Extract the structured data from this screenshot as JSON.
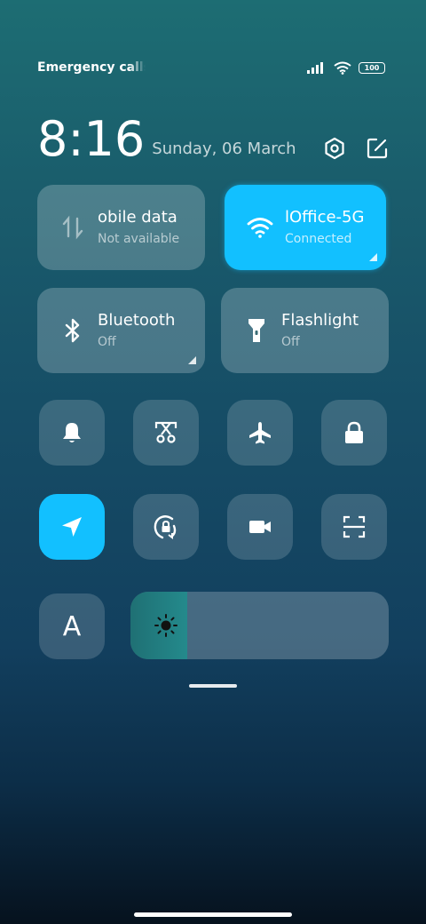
{
  "status_bar": {
    "carrier": "Emergency calls o",
    "battery": "100",
    "icons": [
      "signal-icon",
      "wifi-icon",
      "battery-icon"
    ]
  },
  "header": {
    "time": "8:16",
    "date": "Sunday, 06 March",
    "actions": [
      "settings-icon",
      "edit-icon"
    ]
  },
  "tiles": [
    {
      "id": "mobile-data",
      "title": "obile data",
      "subtitle": "Not available",
      "icon": "mobile-data-icon",
      "active": false
    },
    {
      "id": "wifi",
      "title": "lOffice-5G",
      "subtitle": "Connected",
      "icon": "wifi-icon",
      "active": true
    },
    {
      "id": "bluetooth",
      "title": "Bluetooth",
      "subtitle": "Off",
      "icon": "bluetooth-icon",
      "active": false
    },
    {
      "id": "flashlight",
      "title": "Flashlight",
      "subtitle": "Off",
      "icon": "flashlight-icon",
      "active": false
    }
  ],
  "toggles_row1": [
    "bell-icon",
    "screenshot-icon",
    "airplane-icon",
    "lock-icon"
  ],
  "toggles_row2": [
    "location-icon",
    "rotation-lock-icon",
    "video-camera-icon",
    "scanner-icon"
  ],
  "font_button": {
    "label": "A"
  },
  "brightness": {
    "level": 0.22,
    "icon": "sun-icon"
  },
  "colors": {
    "accent": "#12c0ff"
  }
}
